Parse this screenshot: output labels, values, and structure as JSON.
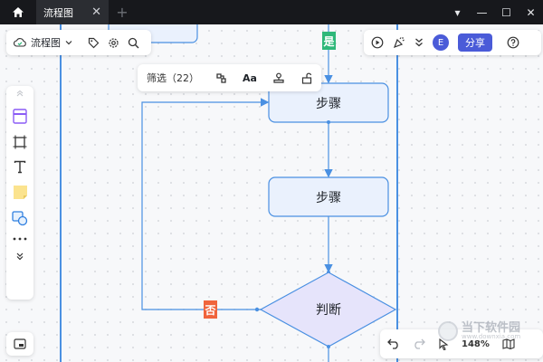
{
  "titlebar": {
    "tab_title": "流程图",
    "tab_close": "✕",
    "new_tab": "+",
    "window_controls": [
      "▾",
      "—",
      "☐",
      "✕"
    ]
  },
  "file_panel": {
    "title": "流程图"
  },
  "float_toolbar": {
    "filter_label": "筛选（22）",
    "font_label": "Aa"
  },
  "right_toolbar": {
    "avatar_initial": "E",
    "share_label": "分享"
  },
  "flow": {
    "nodes": [
      {
        "id": "step1",
        "label": "步骤"
      },
      {
        "id": "step2",
        "label": "步骤"
      },
      {
        "id": "decision",
        "label": "判断"
      }
    ],
    "yes_label": "是",
    "no_label": "否"
  },
  "zoom": {
    "level": "148%"
  },
  "watermark": {
    "cn": "当下软件园",
    "en": "www.downxia.com"
  },
  "colors": {
    "accent": "#4a5bd8",
    "line": "#4a90e2",
    "node_fill": "#eaf1fd",
    "decision_fill": "#e6e4fb",
    "yes_badge": "#2fb87a",
    "no_badge": "#f0643c"
  }
}
